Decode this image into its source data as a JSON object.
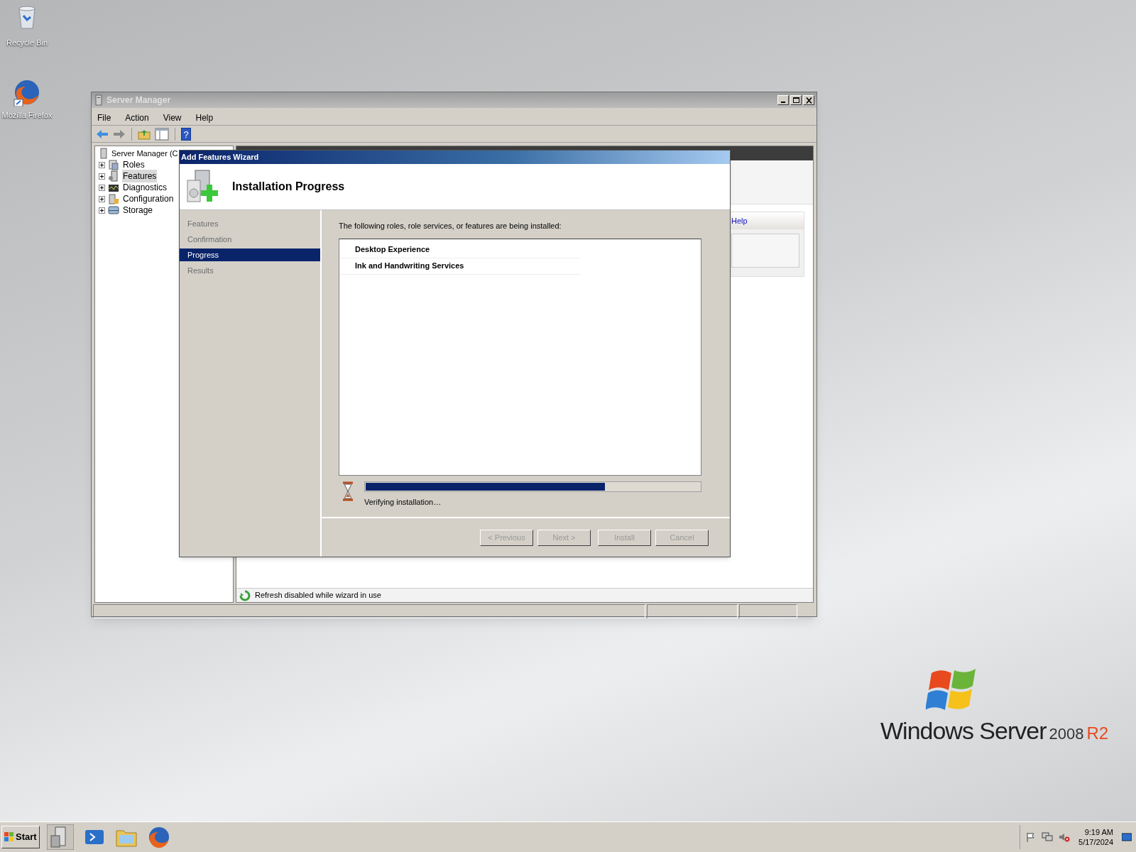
{
  "desktop_icons": [
    {
      "label": "Recycle Bin"
    },
    {
      "label": "Mozilla Firefox"
    }
  ],
  "server_manager": {
    "title": "Server Manager",
    "menu": [
      "File",
      "Action",
      "View",
      "Help"
    ],
    "tree_root": "Server Manager (C",
    "tree": [
      {
        "label": "Roles",
        "selected": false,
        "expanded": false
      },
      {
        "label": "Features",
        "selected": true,
        "expanded": false
      },
      {
        "label": "Diagnostics",
        "selected": false,
        "expanded": false
      },
      {
        "label": "Configuration",
        "selected": false,
        "expanded": false
      },
      {
        "label": "Storage",
        "selected": false,
        "expanded": false
      }
    ],
    "help_icon_glyph": "?",
    "help_link": "Help",
    "status_text": "Refresh disabled while wizard in use"
  },
  "wizard": {
    "title": "Add Features Wizard",
    "heading": "Installation Progress",
    "steps": [
      {
        "label": "Features",
        "selected": false
      },
      {
        "label": "Confirmation",
        "selected": false
      },
      {
        "label": "Progress",
        "selected": true
      },
      {
        "label": "Results",
        "selected": false
      }
    ],
    "intro": "The following roles, role services, or features are being installed:",
    "items": [
      "Desktop Experience",
      "Ink and Handwriting Services"
    ],
    "progress": {
      "level": 0.715
    },
    "status": "Verifying installation…",
    "buttons": [
      {
        "label": "< Previous",
        "disabled": true
      },
      {
        "label": "Next >",
        "disabled": true
      },
      {
        "label": "Install",
        "disabled": true
      },
      {
        "label": "Cancel",
        "disabled": true
      }
    ]
  },
  "logo": {
    "name": "Windows Server",
    "version": "2008",
    "edition": "R2"
  },
  "taskbar": {
    "start": "Start",
    "time": "9:19 AM",
    "date": "5/17/2024"
  }
}
